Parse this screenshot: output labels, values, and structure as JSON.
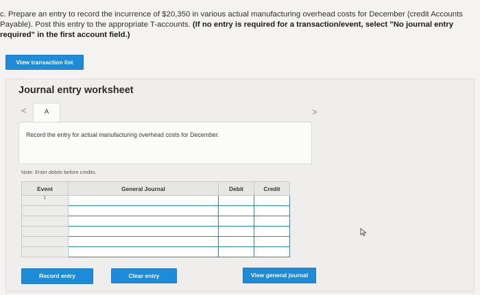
{
  "instructions": {
    "line1": "c. Prepare an entry to record the incurrence of $20,350 in various actual manufacturing overhead costs for December (credit Accounts",
    "line2": "Payable). Post this entry to the appropriate T-accounts. ",
    "line2_bold": "(If no entry is required for a transaction/event, select \"No journal entry",
    "line3_bold": "required\" in the first account field.)"
  },
  "buttons": {
    "view_transaction_list": "View transaction list",
    "record_entry": "Record entry",
    "clear_entry": "Clear entry",
    "view_general_journal": "View general journal"
  },
  "worksheet": {
    "title": "Journal entry worksheet",
    "tab_label": "A",
    "prev_arrow": "<",
    "next_arrow": ">",
    "record_text": "Record the entry for actual manufacturing overhead costs for December.",
    "note": "Note: Enter debits before credits."
  },
  "table": {
    "headers": [
      "Event",
      "General Journal",
      "Debit",
      "Credit"
    ],
    "event_number": "1"
  },
  "colors": {
    "accent": "#1e8bd8",
    "input_border": "#2a84c9"
  }
}
